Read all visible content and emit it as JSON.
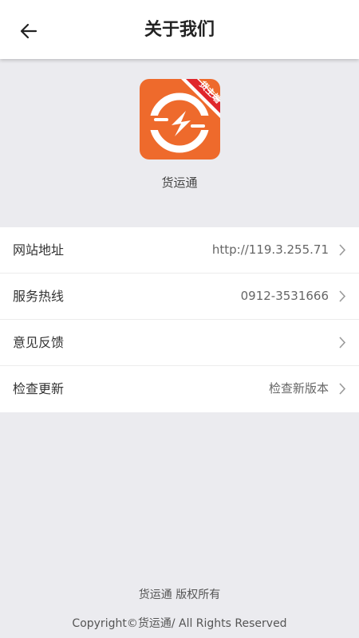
{
  "colors": {
    "background": "#ebebef",
    "header": "#ffffff",
    "logo_orange": "#ee6a2c",
    "badge_red": "#e0262c",
    "text_primary": "#333333",
    "text_secondary": "#666666"
  },
  "header": {
    "back_icon": "arrow-left-icon",
    "title": "关于我们"
  },
  "app": {
    "logo_icon": "app-logo-icon",
    "badge": "货主端",
    "name": "货运通"
  },
  "rows": [
    {
      "label": "网站地址",
      "value": "http://119.3.255.71",
      "icon": "chevron-right-icon"
    },
    {
      "label": "服务热线",
      "value": "0912-3531666",
      "icon": "chevron-right-icon"
    },
    {
      "label": "意见反馈",
      "value": "",
      "icon": "chevron-right-icon"
    },
    {
      "label": "检查更新",
      "value": "检查新版本",
      "icon": "chevron-right-icon"
    }
  ],
  "footer": {
    "rights": "货运通 版权所有",
    "copyright": "Copyright©货运通/ All Rights Reserved"
  }
}
